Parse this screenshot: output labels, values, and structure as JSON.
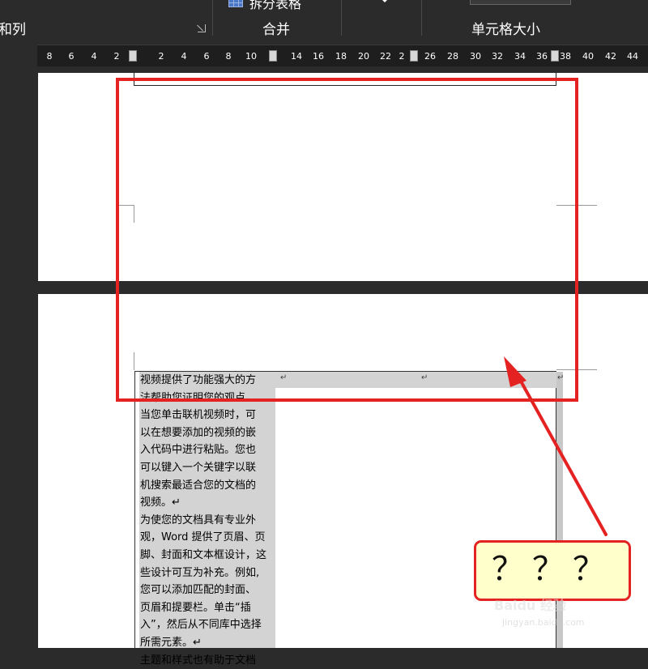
{
  "ribbon": {
    "group_rows_cols_label": "和列",
    "group_merge_label": "合并",
    "group_cell_size_label": "单元格大小",
    "split_table_label": "拆分表格"
  },
  "ruler": {
    "left_ticks": [
      "8",
      "6",
      "4",
      "2"
    ],
    "right_ticks": [
      "2",
      "4",
      "6",
      "8",
      "10",
      "14",
      "16",
      "18",
      "20",
      "22",
      "2",
      "26",
      "28",
      "30",
      "32",
      "34",
      "36",
      "38",
      "40",
      "42",
      "44"
    ]
  },
  "document": {
    "cell_lines": [
      "视频提供了功能强大的方",
      "法帮助您证明您的观点。",
      "当您单击联机视频时，可",
      "以在想要添加的视频的嵌",
      "入代码中进行粘贴。您也",
      "可以键入一个关键字以联",
      "机搜索最适合您的文档的",
      "视频。↵",
      "为使您的文档具有专业外",
      "观，Word 提供了页眉、页",
      "脚、封面和文本框设计，这",
      "些设计可互为补充。例如,",
      "您可以添加匹配的封面、",
      "页眉和提要栏。单击“插",
      "入”，然后从不同库中选择",
      "所需元素。↵",
      "主题和样式也有助于文档"
    ],
    "cell_end_mark": "↵"
  },
  "annotation": {
    "callout_text": "？？？",
    "highlight_color": "#e52222",
    "callout_bg": "#ffffcc"
  },
  "watermark": {
    "brand": "Baidu 经验",
    "url": "jingyan.baidu.com"
  }
}
